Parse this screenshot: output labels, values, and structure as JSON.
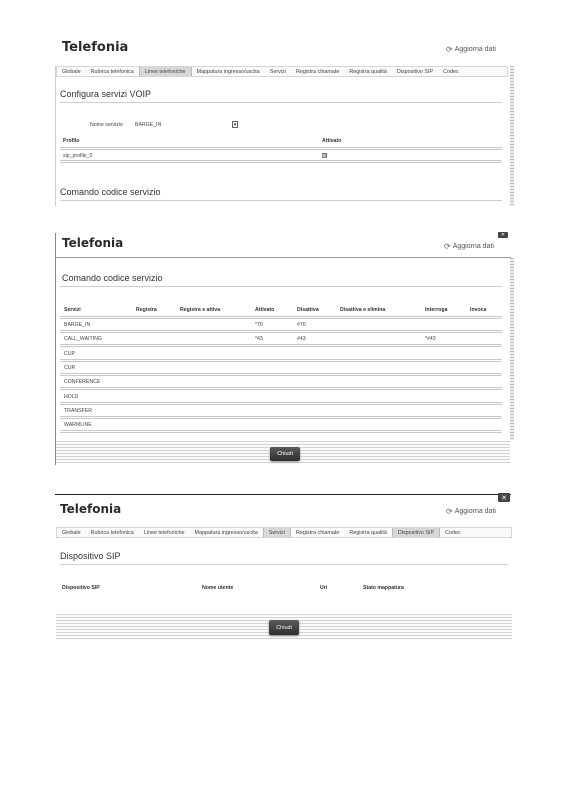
{
  "panel1": {
    "title": "Telefonia",
    "refresh_label": "Aggiorna dati",
    "tabs": [
      "Globale",
      "Rubrica telefonica",
      "Linee telefoniche",
      "Mappatura ingresso/uscita",
      "Servizi",
      "Registra chiamate",
      "Registra qualità",
      "Dispositivo SIP",
      "Codec"
    ],
    "active_tab": "Linee telefoniche",
    "section_title": "Configura servizi VOIP",
    "service_name_label": "Nome servizio",
    "service_name_value": "BARGE_IN",
    "table_headers": [
      "Profilo",
      "Attivato"
    ],
    "rows": [
      {
        "profile": "sip_profile_0",
        "enabled_mark": "☒"
      }
    ],
    "section2_title": "Comando codice servizio"
  },
  "panel2": {
    "title": "Telefonia",
    "refresh_label": "Aggiorna dati",
    "section_title": "Comando codice servizio",
    "headers": [
      "Servizi",
      "Registra",
      "Registra e attiva",
      "Attivato",
      "Disattiva",
      "Disattiva e elimina",
      "Interroga",
      "Invoca"
    ],
    "rows": [
      {
        "service": "BARGE_IN",
        "attivato": "*70",
        "disattiva": "#70",
        "interroga": ""
      },
      {
        "service": "CALL_WAITING",
        "attivato": "*43",
        "disattiva": "#43",
        "interroga": "*#43"
      },
      {
        "service": "CUP",
        "attivato": "",
        "disattiva": "",
        "interroga": ""
      },
      {
        "service": "CUR",
        "attivato": "",
        "disattiva": "",
        "interroga": ""
      },
      {
        "service": "CONFERENCE",
        "attivato": "",
        "disattiva": "",
        "interroga": ""
      },
      {
        "service": "HOLD",
        "attivato": "",
        "disattiva": "",
        "interroga": ""
      },
      {
        "service": "TRANSFER",
        "attivato": "",
        "disattiva": "",
        "interroga": ""
      },
      {
        "service": "WARMLINE",
        "attivato": "",
        "disattiva": "",
        "interroga": ""
      }
    ],
    "close_label": "Chiudi"
  },
  "panel3": {
    "title": "Telefonia",
    "refresh_label": "Aggiorna dati",
    "tabs": [
      "Globale",
      "Rubrica telefonica",
      "Linee telefoniche",
      "Mappatura ingresso/uscita",
      "Servizi",
      "Registra chiamate",
      "Registra qualità",
      "Dispositivo SIP",
      "Codec"
    ],
    "active_tabs": [
      "Servizi",
      "Dispositivo SIP"
    ],
    "section_title": "Dispositivo SIP",
    "headers": [
      "Dispositivo SIP",
      "Nome utente",
      "Uri",
      "Stato mappatura"
    ],
    "close_label": "Chiudi",
    "close_icon_glyph": "✕"
  },
  "icons": {
    "refresh": "refresh-icon",
    "close": "close-icon",
    "dropdown": "dropdown-icon"
  }
}
